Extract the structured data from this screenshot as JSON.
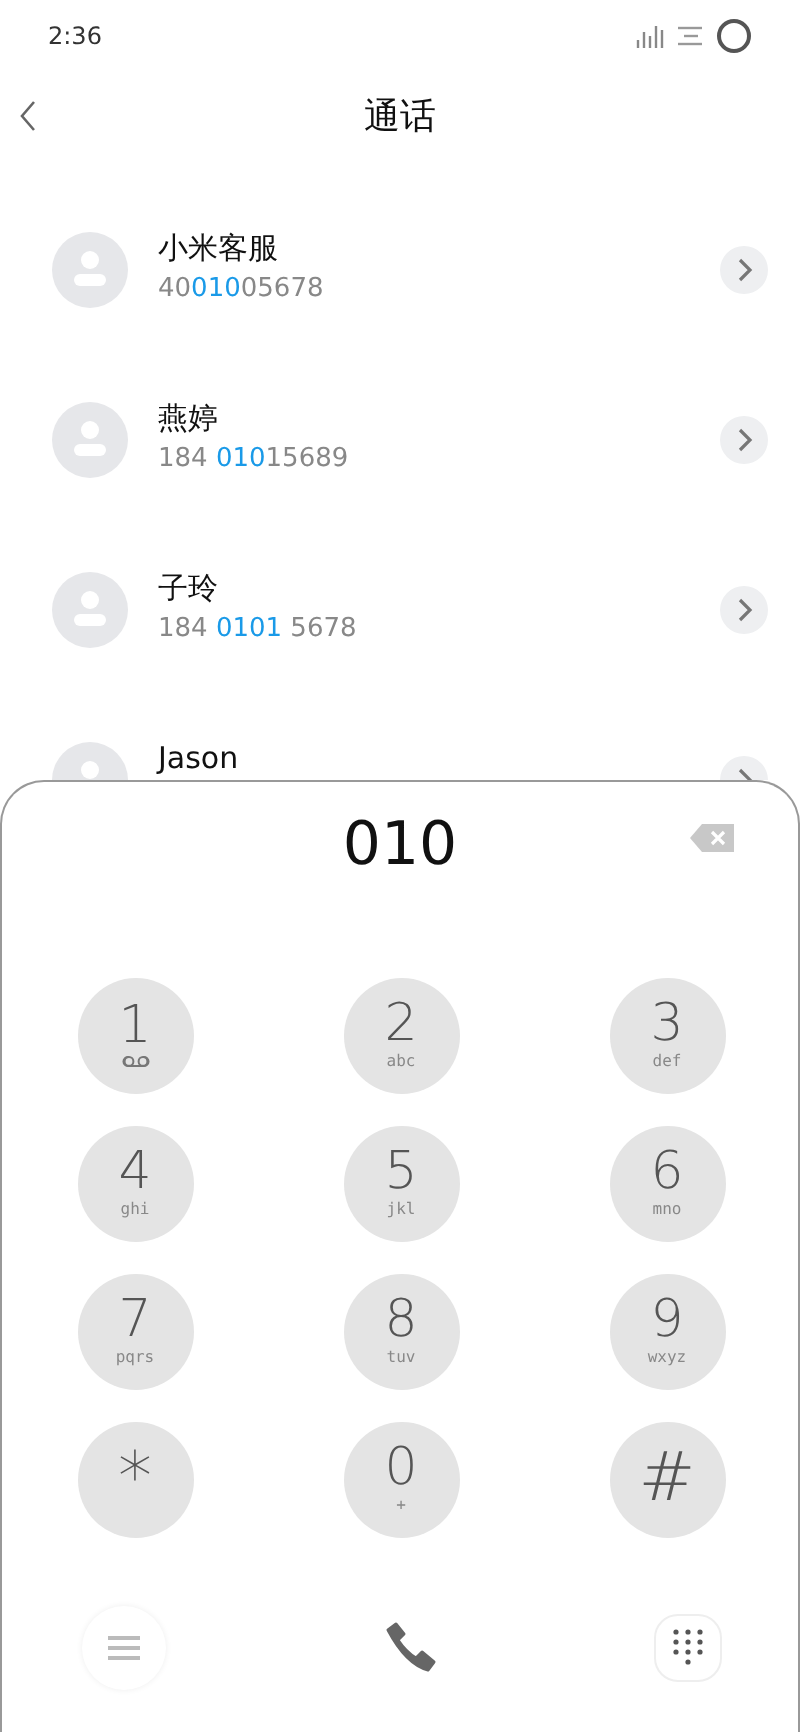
{
  "status_bar": {
    "time": "2:36"
  },
  "header": {
    "title": "通话"
  },
  "contacts": [
    {
      "name": "小米客服",
      "number": [
        {
          "text": "40",
          "match": false
        },
        {
          "text": "010",
          "match": true
        },
        {
          "text": "05678",
          "match": false
        }
      ]
    },
    {
      "name": "燕婷",
      "number": [
        {
          "text": "184 ",
          "match": false
        },
        {
          "text": "010",
          "match": true
        },
        {
          "text": "15689",
          "match": false
        }
      ]
    },
    {
      "name": "子玲",
      "number": [
        {
          "text": "184 ",
          "match": false
        },
        {
          "text": "0101",
          "match": true
        },
        {
          "text": " 5678",
          "match": false
        }
      ]
    },
    {
      "name": "Jason"
    }
  ],
  "dialer": {
    "input": "010",
    "keys": [
      {
        "digit": "1",
        "kind": "voicemail"
      },
      {
        "digit": "2",
        "kind": "letters",
        "letters": "abc"
      },
      {
        "digit": "3",
        "kind": "letters",
        "letters": "def"
      },
      {
        "digit": "4",
        "kind": "letters",
        "letters": "ghi"
      },
      {
        "digit": "5",
        "kind": "letters",
        "letters": "jkl"
      },
      {
        "digit": "6",
        "kind": "letters",
        "letters": "mno"
      },
      {
        "digit": "7",
        "kind": "letters",
        "letters": "pqrs"
      },
      {
        "digit": "8",
        "kind": "letters",
        "letters": "tuv"
      },
      {
        "digit": "9",
        "kind": "letters",
        "letters": "wxyz"
      },
      {
        "digit": "*",
        "kind": "symbol"
      },
      {
        "digit": "0",
        "kind": "letters",
        "letters": "+"
      },
      {
        "digit": "#",
        "kind": "symbol"
      }
    ]
  }
}
